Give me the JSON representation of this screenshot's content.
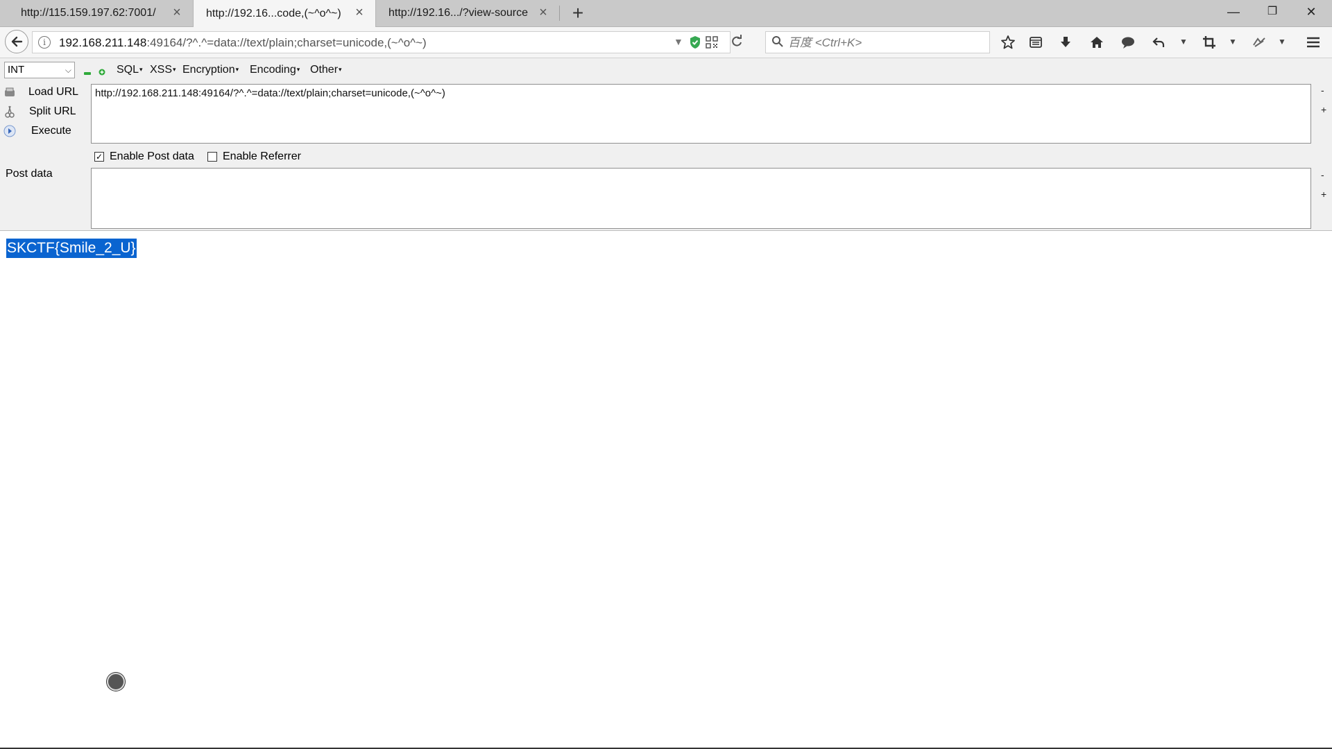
{
  "tabs": [
    {
      "title": "http://115.159.197.62:7001/",
      "active": false
    },
    {
      "title": "http://192.16...code,(~^o^~)",
      "active": true
    },
    {
      "title": "http://192.16.../?view-source",
      "active": false
    }
  ],
  "window_controls": {
    "minimize": "—",
    "restore": "❐",
    "close": "✕"
  },
  "navbar": {
    "url_host": "192.168.211.148",
    "url_rest": ":49164/?^.^=data://text/plain;charset=unicode,(~^o^~)",
    "search_placeholder": "百度 <Ctrl+K>"
  },
  "hackbar": {
    "select_value": "INT",
    "menus": [
      "SQL",
      "XSS",
      "Encryption",
      "Encoding",
      "Other"
    ],
    "actions": [
      "Load URL",
      "Split URL",
      "Execute"
    ],
    "url_value": "http://192.168.211.148:49164/?^.^=data://text/plain;charset=unicode,(~^o^~)",
    "enable_post_label": "Enable Post data",
    "enable_post_checked": true,
    "enable_referrer_label": "Enable Referrer",
    "enable_referrer_checked": false,
    "post_data_label": "Post data",
    "post_data_value": "",
    "minus": "-",
    "plus": "+"
  },
  "page": {
    "flag_text": "SKCTF{Smile_2_U}",
    "selection_color": "#0a64d0"
  },
  "colors": {
    "accent_green": "#2faa3a",
    "shield_green": "#36a852"
  }
}
